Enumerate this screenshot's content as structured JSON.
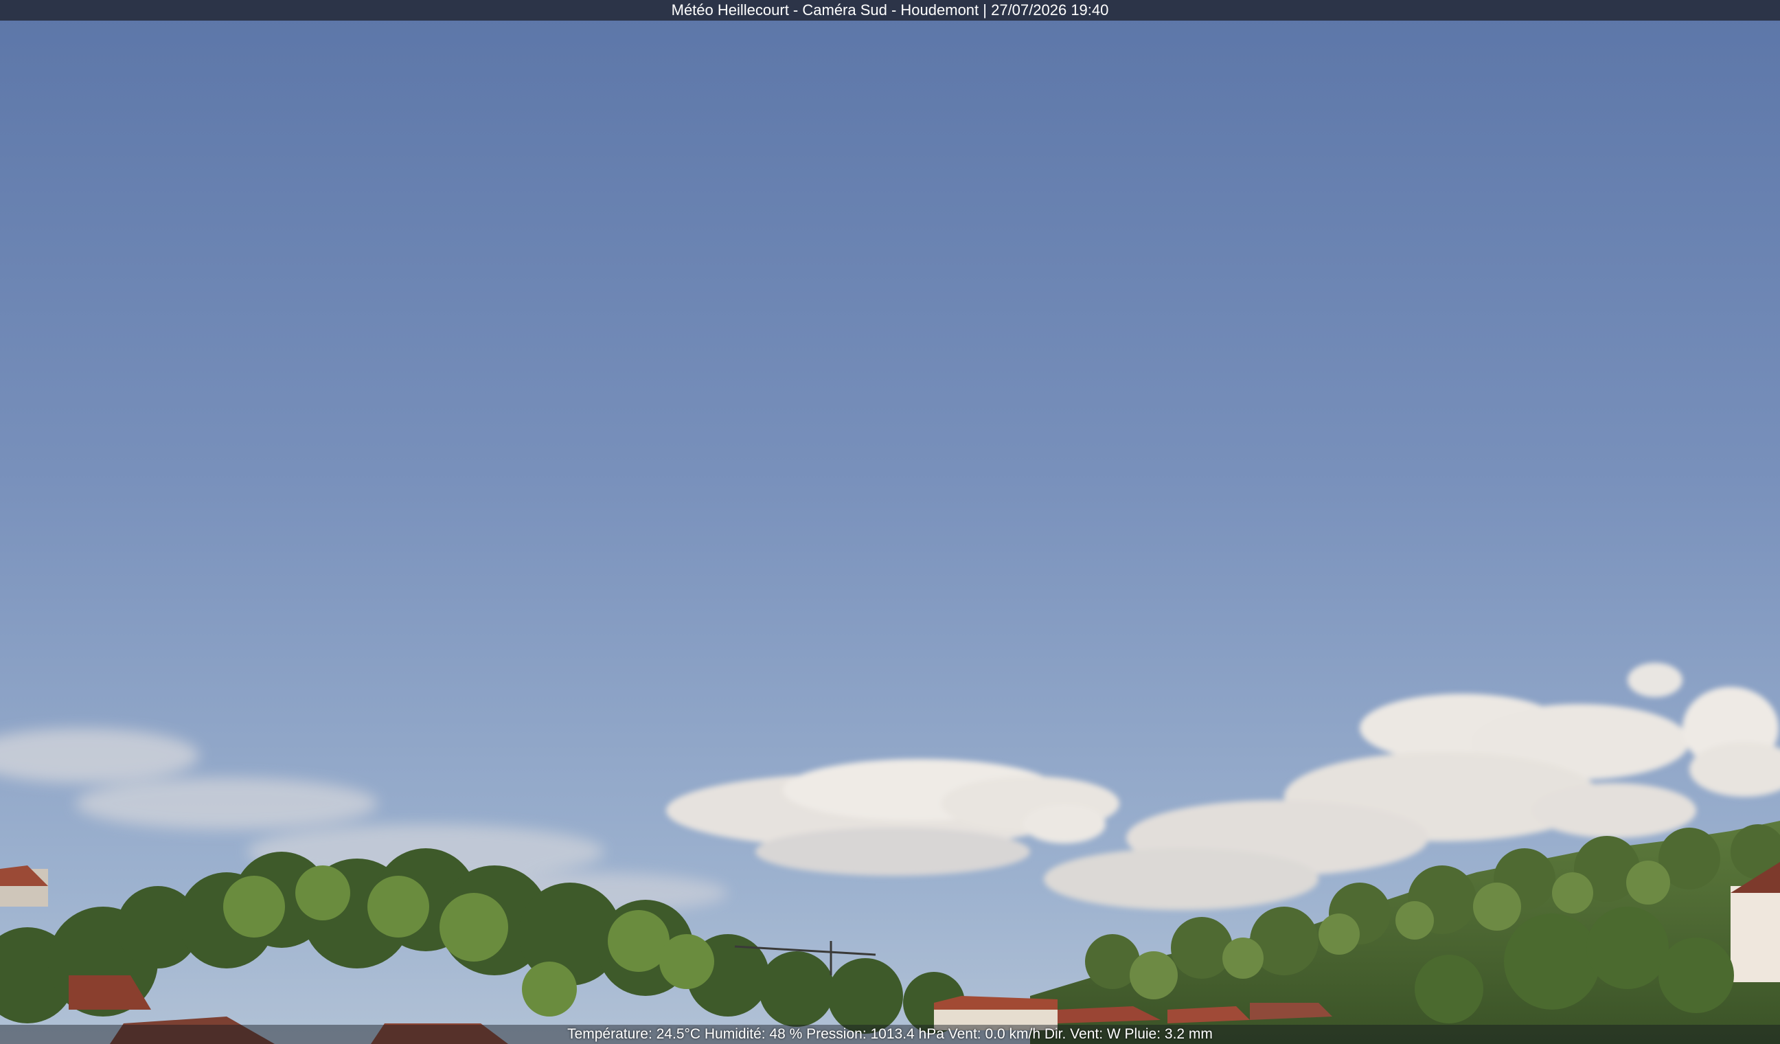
{
  "overlay": {
    "title": "Météo Heillecourt - Caméra Sud - Houdemont | 27/07/2026 19:40",
    "readout": "Température: 24.5°C  Humidité: 48 % Pression: 1013.4 hPa Vent: 0.0 km/h Dir. Vent: W Pluie: 3.2 mm"
  },
  "colors": {
    "sky_top": "#5f78a6",
    "sky_mid": "#7e95bc",
    "sky_horizon": "#a9bbd2",
    "cloud": "#e4e0dc",
    "foliage_dark": "#3f5a2a",
    "foliage_light": "#7a9a4a",
    "roof": "#9c4a32"
  }
}
